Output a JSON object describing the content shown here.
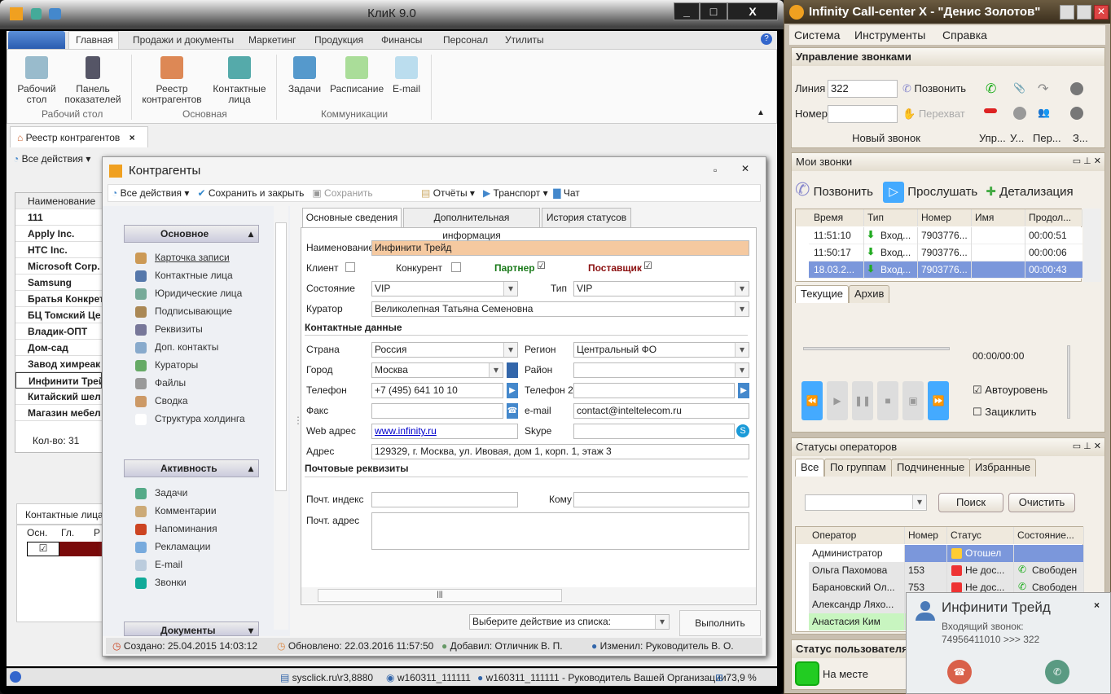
{
  "left_app": {
    "title": "КлиК 9.0",
    "ribbon_tabs": [
      "Главная",
      "Продажи и документы",
      "Маркетинг",
      "Продукция",
      "Финансы",
      "Персонал",
      "Утилиты"
    ],
    "ribbon_buttons": [
      {
        "label": "Рабочий стол",
        "icon": "desktop-icon"
      },
      {
        "label": "Панель показателей",
        "icon": "dashboard-icon"
      },
      {
        "label": "Реестр контрагентов",
        "icon": "house-icon"
      },
      {
        "label": "Контактные лица",
        "icon": "people-icon"
      },
      {
        "label": "Задачи",
        "icon": "tasks-icon"
      },
      {
        "label": "Расписание",
        "icon": "calendar-icon"
      },
      {
        "label": "E-mail",
        "icon": "mail-icon"
      }
    ],
    "ribbon_groups": [
      "Рабочий стол",
      "Основная",
      "Коммуникации"
    ],
    "doc_tab": "Реестр контрагентов",
    "toolbar_all_actions": "Все действия",
    "grid": {
      "header": "Наименование",
      "rows": [
        "111",
        "Apply Inc.",
        "HTC Inc.",
        "Microsoft Corp.",
        "Samsung",
        "Братья Конкрет",
        "БЦ Томский Це",
        "Владик-ОПТ",
        "Дом-сад",
        "Завод химреак",
        "Инфинити Трейд",
        "Китайский шел",
        "Магазин мебел"
      ],
      "count": "Кол-во: 31"
    },
    "contacts_tab": "Контактные лица",
    "contacts_cols": [
      "Осн.",
      "Гл.",
      "Р"
    ],
    "status_bar": {
      "server": "sysclick.ru\\r3,8880",
      "db": "w160311_111111",
      "user": "w160311_111111 - Руководитель Вашей Организации",
      "percent": "73,9 %"
    }
  },
  "dialog": {
    "title": "Контрагенты",
    "toolbar": {
      "all_actions": "Все действия",
      "save_close": "Сохранить и закрыть",
      "save": "Сохранить",
      "reports": "Отчёты",
      "transport": "Транспорт",
      "chat": "Чат"
    },
    "sections": [
      {
        "title": "Основное",
        "items": [
          "Карточка записи",
          "Контактные лица",
          "Юридические лица",
          "Подписывающие",
          "Реквизиты",
          "Доп. контакты",
          "Кураторы",
          "Файлы",
          "Сводка",
          "Структура холдинга"
        ]
      },
      {
        "title": "Активность",
        "items": [
          "Задачи",
          "Комментарии",
          "Напоминания",
          "Рекламации",
          "E-mail",
          "Звонки"
        ]
      },
      {
        "title": "Документы",
        "items": []
      }
    ],
    "tabs": [
      "Основные сведения",
      "Дополнительная информация",
      "История статусов"
    ],
    "form": {
      "name_label": "Наименование",
      "name": "Инфинити Трейд",
      "client": "Клиент",
      "competitor": "Конкурент",
      "partner": "Партнер",
      "supplier": "Поставщик",
      "state_label": "Состояние",
      "state": "VIP",
      "type_label": "Тип",
      "type": "VIP",
      "curator_label": "Куратор",
      "curator": "Великолепная Татьяна Семеновна",
      "contacts_heading": "Контактные данные",
      "country_label": "Страна",
      "country": "Россия",
      "region_label": "Регион",
      "region": "Центральный ФО",
      "city_label": "Город",
      "city": "Москва",
      "district_label": "Район",
      "district": "",
      "phone_label": "Телефон",
      "phone": "+7 (495) 641 10 10",
      "phone2_label": "Телефон 2",
      "phone2": "",
      "fax_label": "Факс",
      "fax": "",
      "email_label": "e-mail",
      "email": "contact@inteltelecom.ru",
      "web_label": "Web адрес",
      "web": "www.infinity.ru",
      "skype_label": "Skype",
      "skype": "",
      "address_label": "Адрес",
      "address": "129329, г. Москва, ул. Ивовая, дом 1, корп. 1, этаж 3",
      "postal_heading": "Почтовые реквизиты",
      "zip_label": "Почт. индекс",
      "to_label": "Кому",
      "postal_label": "Почт. адрес"
    },
    "action_placeholder": "Выберите действие из списка:",
    "execute": "Выполнить",
    "footer": {
      "created": "Создано: 25.04.2015 14:03:12",
      "updated": "Обновлено: 22.03.2016 11:57:50",
      "added": "Добавил: Отличник В. П.",
      "changed": "Изменил: Руководитель В. О."
    }
  },
  "right_app": {
    "title": "Infinity Call-center X - \"Денис Золотов\"",
    "menu": [
      "Система",
      "Инструменты",
      "Справка"
    ],
    "call_control": {
      "title": "Управление звонками",
      "line_label": "Линия",
      "line": "322",
      "number_label": "Номер",
      "call": "Позвонить",
      "intercept": "Перехват",
      "group_new": "Новый звонок",
      "groups": [
        "Упр...",
        "У...",
        "Пер...",
        "З..."
      ]
    },
    "my_calls": {
      "title": "Мои звонки",
      "call": "Позвонить",
      "listen": "Прослушать",
      "details": "Детализация",
      "columns": [
        "Время",
        "Тип",
        "Номер",
        "Имя",
        "Продол..."
      ],
      "rows": [
        [
          "11:51:10",
          "Вход...",
          "7903776...",
          "",
          "00:00:51"
        ],
        [
          "11:50:17",
          "Вход...",
          "7903776...",
          "",
          "00:00:06"
        ],
        [
          "18.03.2...",
          "Вход...",
          "7903776...",
          "",
          "00:00:43"
        ]
      ],
      "tabs": [
        "Текущие",
        "Архив"
      ],
      "time": "00:00/00:00",
      "auto_level": "Автоуровень",
      "loop": "Зациклить",
      "auto_level_checked": true,
      "loop_checked": false
    },
    "operators": {
      "title": "Статусы операторов",
      "tabs": [
        "Все",
        "По группам",
        "Подчиненные",
        "Избранные"
      ],
      "search": "Поиск",
      "clear": "Очистить",
      "columns": [
        "Оператор",
        "Номер",
        "Статус",
        "Состояние..."
      ],
      "rows": [
        [
          "Администратор",
          "",
          "Отошел",
          ""
        ],
        [
          "Ольга Пахомова",
          "153",
          "Не дос...",
          "Свободен"
        ],
        [
          "Барановский Ол...",
          "753",
          "Не дос...",
          "Свободен"
        ],
        [
          "Александр Ляхо...",
          "",
          "",
          ""
        ],
        [
          "Анастасия Ким",
          "",
          "",
          ""
        ]
      ]
    },
    "user_status": {
      "title": "Статус пользователя",
      "value": "На месте"
    },
    "popup": {
      "name": "Инфинити Трейд",
      "line1": "Входящий звонок:",
      "line2": "74956411010 >>> 322"
    }
  },
  "colors": {
    "selected_row": "#7b97db",
    "partner": "#1a7a1a",
    "supplier": "#8b1010",
    "name_field": "#f5c9a0",
    "green_row": "#c8f5c0"
  }
}
